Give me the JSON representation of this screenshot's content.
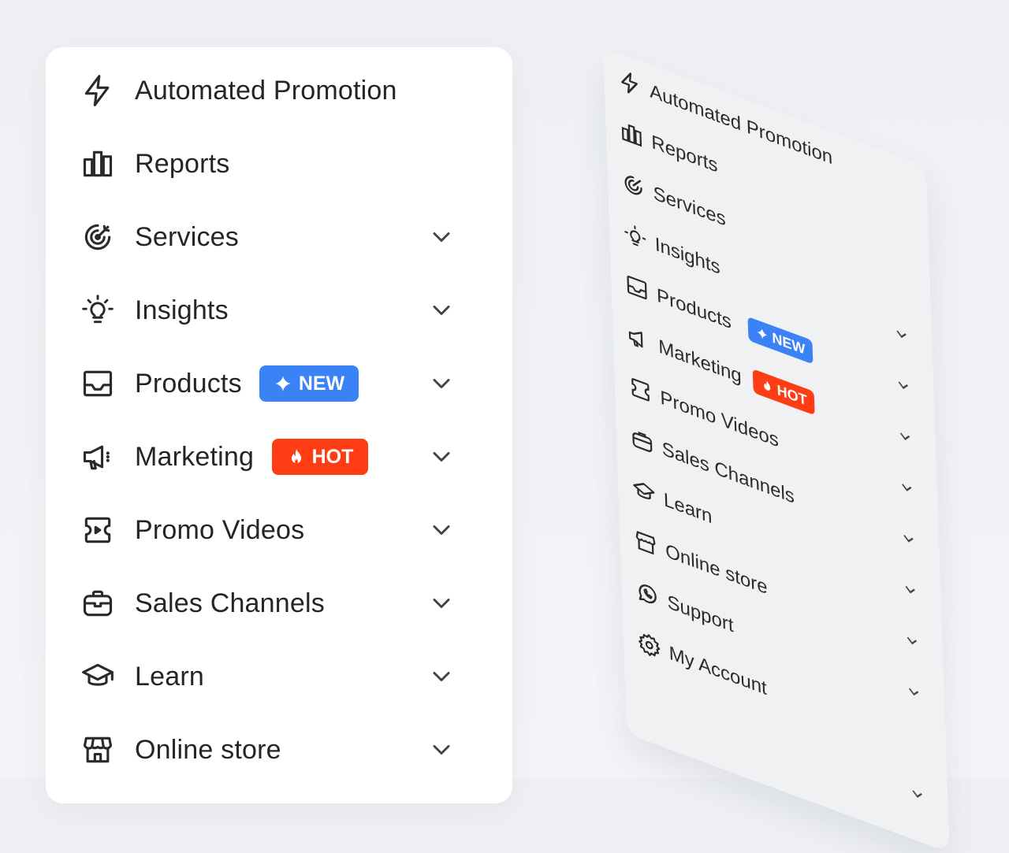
{
  "menu": {
    "items": [
      {
        "label": "Automated Promotion",
        "icon": "bolt-icon"
      },
      {
        "label": "Reports",
        "icon": "bar-chart-icon"
      },
      {
        "label": "Services",
        "icon": "target-icon"
      },
      {
        "label": "Insights",
        "icon": "lightbulb-icon"
      },
      {
        "label": "Products",
        "icon": "inbox-icon"
      },
      {
        "label": "Marketing",
        "icon": "megaphone-icon"
      },
      {
        "label": "Promo Videos",
        "icon": "video-ticket-icon"
      },
      {
        "label": "Sales Channels",
        "icon": "briefcase-icon"
      },
      {
        "label": "Learn",
        "icon": "graduation-cap-icon"
      },
      {
        "label": "Online store",
        "icon": "store-icon"
      },
      {
        "label": "Support",
        "icon": "whatsapp-icon"
      },
      {
        "label": "My Account",
        "icon": "gear-icon"
      }
    ],
    "badges": {
      "new": "NEW",
      "hot": "HOT"
    }
  },
  "colors": {
    "new_badge": "#3b82f6",
    "hot_badge": "#ff3d14"
  }
}
